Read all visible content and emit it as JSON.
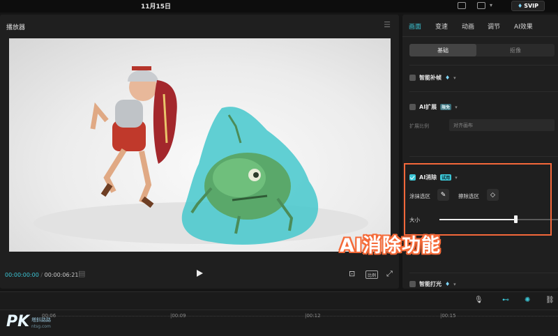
{
  "topbar": {
    "date": "11月15日",
    "vip_label": "SVIP"
  },
  "player": {
    "title": "播放器",
    "current_time": "00:00:00:00",
    "total_time": "00:00:06:21",
    "ratio_label": "比例"
  },
  "right_panel": {
    "tabs": [
      "画面",
      "变速",
      "动画",
      "调节",
      "AI效果"
    ],
    "active_tab": "画面",
    "segments": [
      "基础",
      "抠像"
    ],
    "items": {
      "smart_fill": "智能补帧",
      "ai_expand": "AI扩展",
      "ai_expand_badge": "限免",
      "expand_ratio_label": "扩展比例",
      "expand_ratio_placeholder": "对齐画布",
      "ai_erase": "AI消除",
      "ai_erase_badge": "试用",
      "brush_select": "涂抹选区",
      "erase_select": "擦除选区",
      "size_label": "大小",
      "size_value": 0.64,
      "smart_light": "智能打光"
    }
  },
  "annotation": {
    "caption": "AI消除功能",
    "color": "#f5683a"
  },
  "timeline": {
    "marks": [
      "00:06",
      "|00:09",
      "|00:12",
      "|00:15"
    ]
  },
  "watermark": {
    "logo": "PK",
    "line1": "塔鈄路路",
    "line2": "ntsg.com"
  },
  "colors": {
    "accent": "#3cc6d6",
    "panel_bg": "#1f1f1f",
    "app_bg": "#151515"
  }
}
